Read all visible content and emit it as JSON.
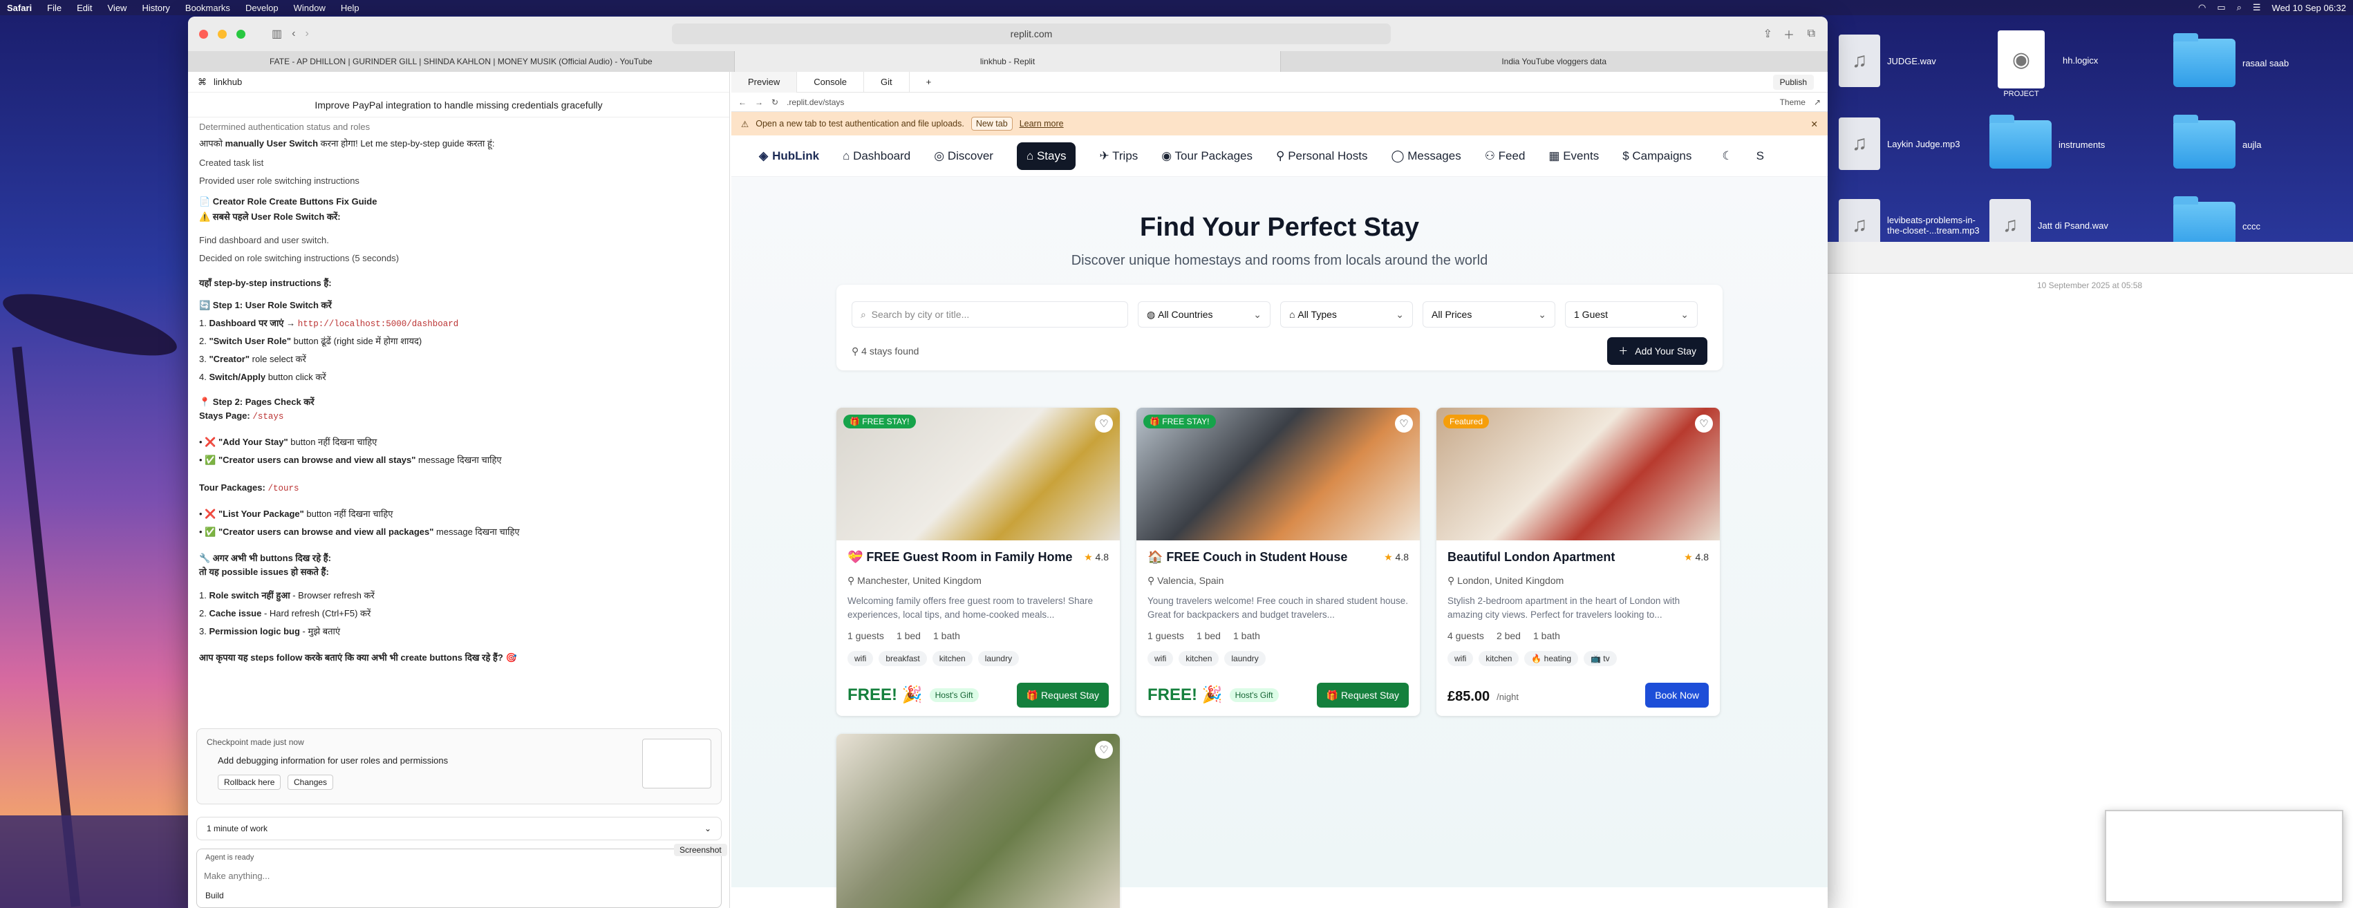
{
  "menubar": {
    "app": "Safari",
    "items": [
      "File",
      "Edit",
      "View",
      "History",
      "Bookmarks",
      "Develop",
      "Window",
      "Help"
    ],
    "clock": "Wed 10 Sep 06:32"
  },
  "desktop": {
    "items": [
      {
        "label": "JUDGE.wav",
        "kind": "file"
      },
      {
        "label": "PROJECT",
        "kind": "project"
      },
      {
        "label": "hh.logicx",
        "kind": "file"
      },
      {
        "label": "rasaal saab",
        "kind": "folder"
      },
      {
        "label": "Laykin Judge.mp3",
        "kind": "file"
      },
      {
        "label": "instruments",
        "kind": "folder"
      },
      {
        "label": "aujla",
        "kind": "folder"
      },
      {
        "label": "levibeats-problems-in-the-closet-...tream.mp3",
        "kind": "file"
      },
      {
        "label": "Jatt di Psand.wav",
        "kind": "file"
      },
      {
        "label": "cccc",
        "kind": "folder"
      }
    ],
    "notes_date": "10 September 2025 at 05:58"
  },
  "browser": {
    "address": "replit.com",
    "tabs": [
      "FATE - AP DHILLON | GURINDER GILL | SHINDA KAHLON | MONEY MUSIK (Official Audio) - YouTube",
      "linkhub - Replit",
      "India YouTube vloggers data"
    ]
  },
  "chat": {
    "project": "linkhub",
    "title": "Improve PayPal integration to handle missing credentials gracefully",
    "lines": {
      "l0": "Determined authentication status and roles",
      "l1a": "आपको ",
      "l1b": "manually User Switch",
      "l1c": " करना होगा! Let me step-by-step guide करता हूं:",
      "l2": "Created task list",
      "l3": "Provided user role switching instructions",
      "l4": "📄 Creator Role Create Buttons Fix Guide",
      "l5": "⚠️ सबसे पहले User Role Switch करें:",
      "l6": "Find dashboard and user switch.",
      "l7": "Decided on role switching instructions (5 seconds)",
      "l8": "यहाँ step-by-step instructions हैं:",
      "l9": "🔄 Step 1: User Role Switch करें",
      "s1a": "Dashboard पर जाएं →",
      "s1b": "http://localhost:5000/dashboard",
      "s2a": "\"Switch User Role\"",
      "s2b": " button ढूंढें (right side में होगा शायद)",
      "s3a": "\"Creator\"",
      "s3b": " role select करें",
      "s4a": "Switch/Apply",
      "s4b": " button click करें",
      "l10": "📍 Step 2: Pages Check करें",
      "l11a": "Stays Page:",
      "l11b": "/stays",
      "b1a": "❌ \"Add Your Stay\"",
      "b1b": " button नहीं दिखना चाहिए",
      "b2a": "✅ \"Creator users can browse and view all stays\"",
      "b2b": " message दिखना चाहिए",
      "l12a": "Tour Packages:",
      "l12b": "/tours",
      "b3a": "❌ \"List Your Package\"",
      "b3b": " button नहीं दिखना चाहिए",
      "b4a": "✅ \"Creator users can browse and view all packages\"",
      "b4b": " message दिखना चाहिए",
      "l13": "🔧 अगर अभी भी buttons दिख रहे हैं:",
      "l14": "तो यह possible issues हो सकते हैं:",
      "i1a": "Role switch नहीं हुआ",
      "i1b": " - Browser refresh करें",
      "i2a": "Cache issue",
      "i2b": " - Hard refresh (Ctrl+F5) करें",
      "i3a": "Permission logic bug",
      "i3b": " - मुझे बताएं",
      "l15": "आप कृपया यह steps follow करके बताएं कि क्या अभी भी create buttons दिख रहे हैं? 🎯"
    },
    "checkpoint": {
      "label": "Checkpoint made just now",
      "desc": "Add debugging information for user roles and permissions",
      "rollback": "Rollback here",
      "changes": "Changes"
    },
    "work": "1 minute of work",
    "status": "Agent is ready",
    "placeholder": "Make anything...",
    "build": "Build",
    "screenshot": "Screenshot"
  },
  "preview": {
    "tabs": [
      "Preview",
      "Console",
      "Git"
    ],
    "url": ".replit.dev/stays",
    "theme": "Theme",
    "publish": "Publish",
    "banner": {
      "text": "Open a new tab to test authentication and file uploads.",
      "newtab": "New tab",
      "learn": "Learn more"
    }
  },
  "site": {
    "logo": "HubLink",
    "nav": [
      "Dashboard",
      "Discover",
      "Stays",
      "Trips",
      "Tour Packages",
      "Personal Hosts",
      "Messages",
      "Feed",
      "Events",
      "Campaigns"
    ],
    "nav_end": "S",
    "title": "Find Your Perfect Stay",
    "subtitle": "Discover unique homestays and rooms from locals around the world",
    "search_placeholder": "Search by city or title...",
    "countries": "All Countries",
    "types": "All Types",
    "prices": "All Prices",
    "guests": "1 Guest",
    "found": "4 stays found",
    "add": "Add Your Stay",
    "cards": [
      {
        "badge": "🎁 FREE STAY!",
        "badge_color": "#16a34a",
        "title": "💝 FREE Guest Room in Family Home",
        "rating": "4.8",
        "location": "Manchester, United Kingdom",
        "desc": "Welcoming family offers free guest room to travelers! Share experiences, local tips, and home-cooked meals...",
        "guests": "1 guests",
        "beds": "1 bed",
        "baths": "1 bath",
        "tags": [
          "wifi",
          "breakfast",
          "kitchen",
          "laundry"
        ],
        "price": "FREE! 🎉",
        "gift": "Host's Gift",
        "cta": "🎁 Request Stay",
        "cta_color": "#15803d"
      },
      {
        "badge": "🎁 FREE STAY!",
        "badge_color": "#16a34a",
        "title": "🏠 FREE Couch in Student House",
        "rating": "4.8",
        "location": "Valencia, Spain",
        "desc": "Young travelers welcome! Free couch in shared student house. Great for backpackers and budget travelers...",
        "guests": "1 guests",
        "beds": "1 bed",
        "baths": "1 bath",
        "tags": [
          "wifi",
          "kitchen",
          "laundry"
        ],
        "price": "FREE! 🎉",
        "gift": "Host's Gift",
        "cta": "🎁 Request Stay",
        "cta_color": "#15803d"
      },
      {
        "badge": "Featured",
        "badge_color": "#f59e0b",
        "title": "Beautiful London Apartment",
        "rating": "4.8",
        "location": "London, United Kingdom",
        "desc": "Stylish 2-bedroom apartment in the heart of London with amazing city views. Perfect for travelers looking to...",
        "guests": "4 guests",
        "beds": "2 bed",
        "baths": "1 bath",
        "tags": [
          "wifi",
          "kitchen",
          "🔥 heating",
          "📺 tv"
        ],
        "price": "£85.00",
        "unit": "/night",
        "cta": "Book Now",
        "cta_color": "#1d4ed8"
      }
    ]
  }
}
